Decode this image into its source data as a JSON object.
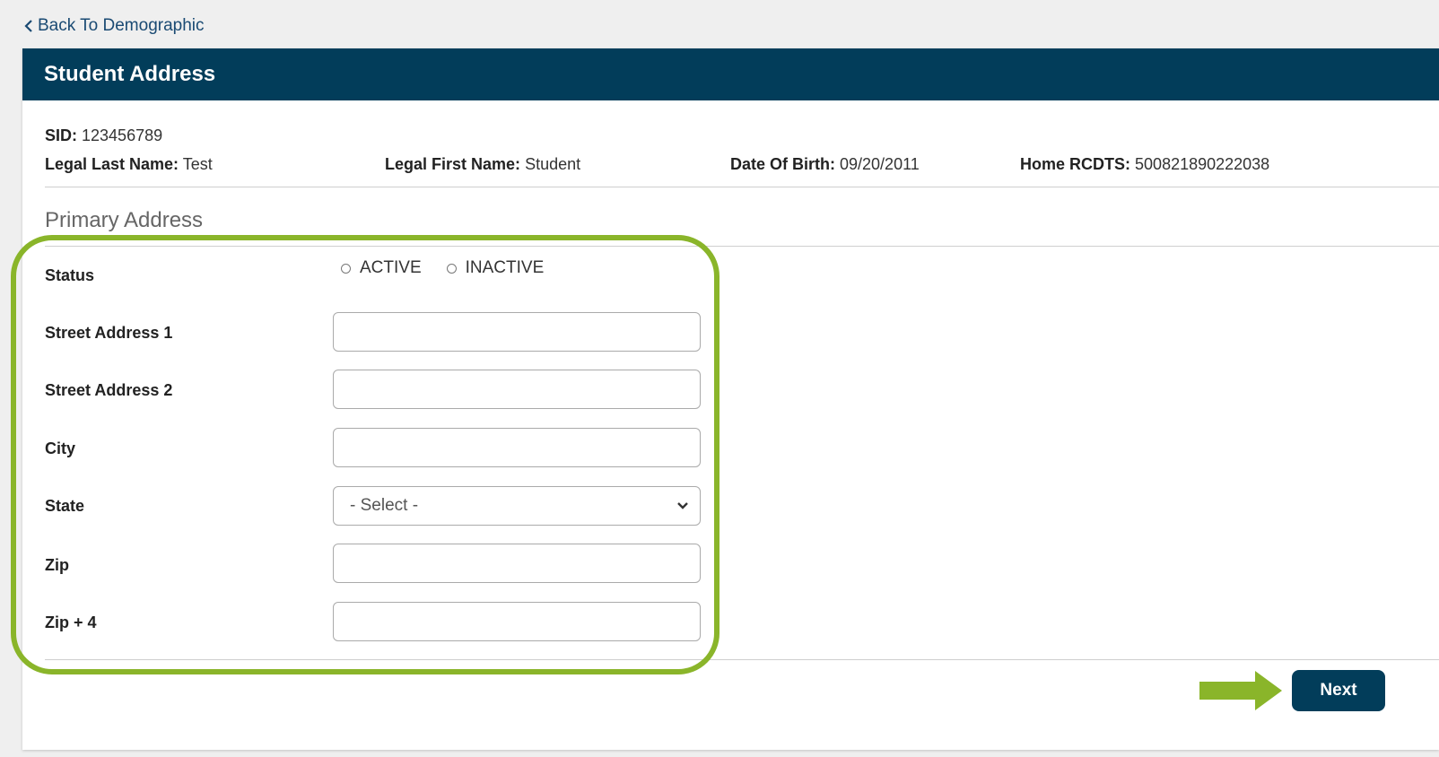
{
  "nav": {
    "back_label": "Back To Demographic"
  },
  "panel": {
    "title": "Student Address"
  },
  "student": {
    "sid_label": "SID:",
    "sid": "123456789",
    "last_name_label": "Legal Last Name:",
    "last_name": "Test",
    "first_name_label": "Legal First Name:",
    "first_name": "Student",
    "dob_label": "Date Of Birth:",
    "dob": "09/20/2011",
    "rcdts_label": "Home RCDTS:",
    "rcdts": "500821890222038"
  },
  "section": {
    "title": "Primary Address"
  },
  "form": {
    "status_label": "Status",
    "status_options": [
      "ACTIVE",
      "INACTIVE"
    ],
    "street1_label": "Street Address 1",
    "street2_label": "Street Address 2",
    "city_label": "City",
    "state_label": "State",
    "state_value": "- Select -",
    "zip_label": "Zip",
    "zip4_label": "Zip + 4"
  },
  "actions": {
    "next_label": "Next"
  },
  "colors": {
    "header": "#023d5a",
    "highlight": "#8ab52a",
    "link": "#1a4a73"
  }
}
